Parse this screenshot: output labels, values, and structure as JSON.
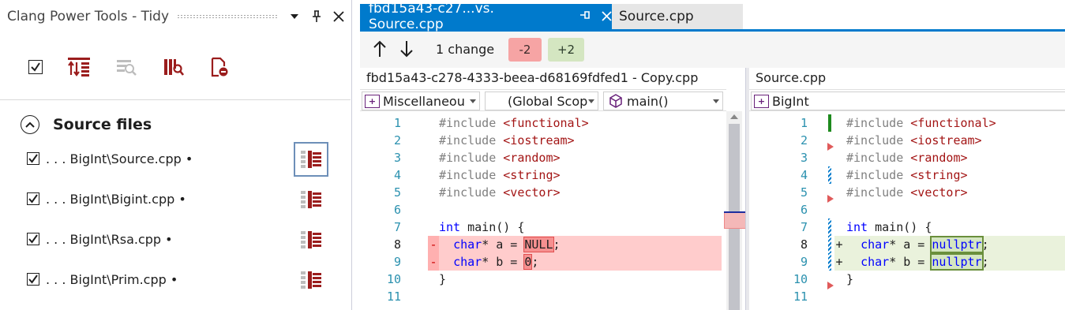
{
  "tool_window": {
    "title": "Clang Power Tools - Tidy",
    "buttons": {
      "menu_glyph": "▼",
      "pin_glyph": "📌",
      "close_glyph": "✕"
    },
    "toolbar_icons": [
      "select-all-checkbox",
      "tidy-fix-icon",
      "tidy-discard-icon",
      "tidy-refresh-icon",
      "file-remove-icon"
    ],
    "section": {
      "title": "Source files",
      "collapse_glyph": "⌃"
    },
    "files": [
      {
        "label": ". . . BigInt\\Source.cpp •",
        "checked": true,
        "focused": true
      },
      {
        "label": ". . . BigInt\\Bigint.cpp •",
        "checked": true,
        "focused": false
      },
      {
        "label": ". . . BigInt\\Rsa.cpp •",
        "checked": true,
        "focused": false
      },
      {
        "label": ". . . BigInt\\Prim.cpp •",
        "checked": true,
        "focused": false
      }
    ]
  },
  "tabs": [
    {
      "label": "fbd15a43-c27...vs. Source.cpp",
      "active": true,
      "pin_glyph": "⊣",
      "close_glyph": "✕"
    },
    {
      "label": "Source.cpp",
      "active": false
    }
  ],
  "diff_toolbar": {
    "up_glyph": "↑",
    "down_glyph": "↓",
    "change_count": "1 change",
    "removed": "-2",
    "added": "+2"
  },
  "left_pane": {
    "file_caption": "fbd15a43-c278-4333-beea-d68169fdfed1 - Copy.cpp",
    "nav": {
      "project": "Miscellaneou",
      "scope": "(Global Scop",
      "member": "main()"
    },
    "lines": [
      {
        "n": "1",
        "tokens": [
          [
            "dir",
            "#include "
          ],
          [
            "str",
            "<functional>"
          ]
        ]
      },
      {
        "n": "2",
        "tokens": [
          [
            "dir",
            "#include "
          ],
          [
            "str",
            "<iostream>"
          ]
        ]
      },
      {
        "n": "3",
        "tokens": [
          [
            "dir",
            "#include "
          ],
          [
            "str",
            "<random>"
          ]
        ]
      },
      {
        "n": "4",
        "tokens": [
          [
            "dir",
            "#include "
          ],
          [
            "str",
            "<string>"
          ]
        ]
      },
      {
        "n": "5",
        "tokens": [
          [
            "dir",
            "#include "
          ],
          [
            "str",
            "<vector>"
          ]
        ]
      },
      {
        "n": "6",
        "tokens": []
      },
      {
        "n": "7",
        "tokens": [
          [
            "kw",
            "int"
          ],
          [
            "txt",
            " main() {"
          ]
        ]
      },
      {
        "n": "8",
        "tokens": [
          [
            "txt",
            "  "
          ],
          [
            "kw",
            "char"
          ],
          [
            "txt",
            "* a = "
          ],
          [
            "del",
            "NULL"
          ],
          [
            "txt",
            ";"
          ]
        ],
        "deleted": true
      },
      {
        "n": "9",
        "tokens": [
          [
            "txt",
            "  "
          ],
          [
            "kw",
            "char"
          ],
          [
            "txt",
            "* b = "
          ],
          [
            "del",
            "0"
          ],
          [
            "txt",
            ";"
          ]
        ],
        "deleted": true
      },
      {
        "n": "10",
        "tokens": [
          [
            "txt",
            "}"
          ]
        ]
      },
      {
        "n": "11",
        "tokens": []
      }
    ]
  },
  "right_pane": {
    "file_caption": "Source.cpp",
    "nav": {
      "project": "BigInt"
    },
    "lines": [
      {
        "n": "1",
        "tokens": [
          [
            "dir",
            "#include "
          ],
          [
            "str",
            "<functional>"
          ]
        ]
      },
      {
        "n": "2",
        "tokens": [
          [
            "dir",
            "#include "
          ],
          [
            "str",
            "<iostream>"
          ]
        ]
      },
      {
        "n": "3",
        "tokens": [
          [
            "dir",
            "#include "
          ],
          [
            "str",
            "<random>"
          ]
        ]
      },
      {
        "n": "4",
        "tokens": [
          [
            "dir",
            "#include "
          ],
          [
            "str",
            "<string>"
          ]
        ]
      },
      {
        "n": "5",
        "tokens": [
          [
            "dir",
            "#include "
          ],
          [
            "str",
            "<vector>"
          ]
        ]
      },
      {
        "n": "6",
        "tokens": []
      },
      {
        "n": "7",
        "tokens": [
          [
            "kw",
            "int"
          ],
          [
            "txt",
            " main() {"
          ]
        ]
      },
      {
        "n": "8",
        "tokens": [
          [
            "txt",
            "  "
          ],
          [
            "kw",
            "char"
          ],
          [
            "txt",
            "* a = "
          ],
          [
            "add",
            "nullptr"
          ],
          [
            "txt",
            ";"
          ]
        ],
        "added": true
      },
      {
        "n": "9",
        "tokens": [
          [
            "txt",
            "  "
          ],
          [
            "kw",
            "char"
          ],
          [
            "txt",
            "* b = "
          ],
          [
            "add",
            "nullptr"
          ],
          [
            "txt",
            ";"
          ]
        ],
        "added": true
      },
      {
        "n": "10",
        "tokens": [
          [
            "txt",
            "}"
          ]
        ]
      },
      {
        "n": "11",
        "tokens": []
      }
    ]
  },
  "markers": {
    "deleted_glyph": "-",
    "added_glyph": "+"
  },
  "colors": {
    "accent": "#007acc",
    "deleted_bg": "#ffcccc",
    "added_bg": "#eaf2dc",
    "tidy_red": "#9b1d1d"
  }
}
